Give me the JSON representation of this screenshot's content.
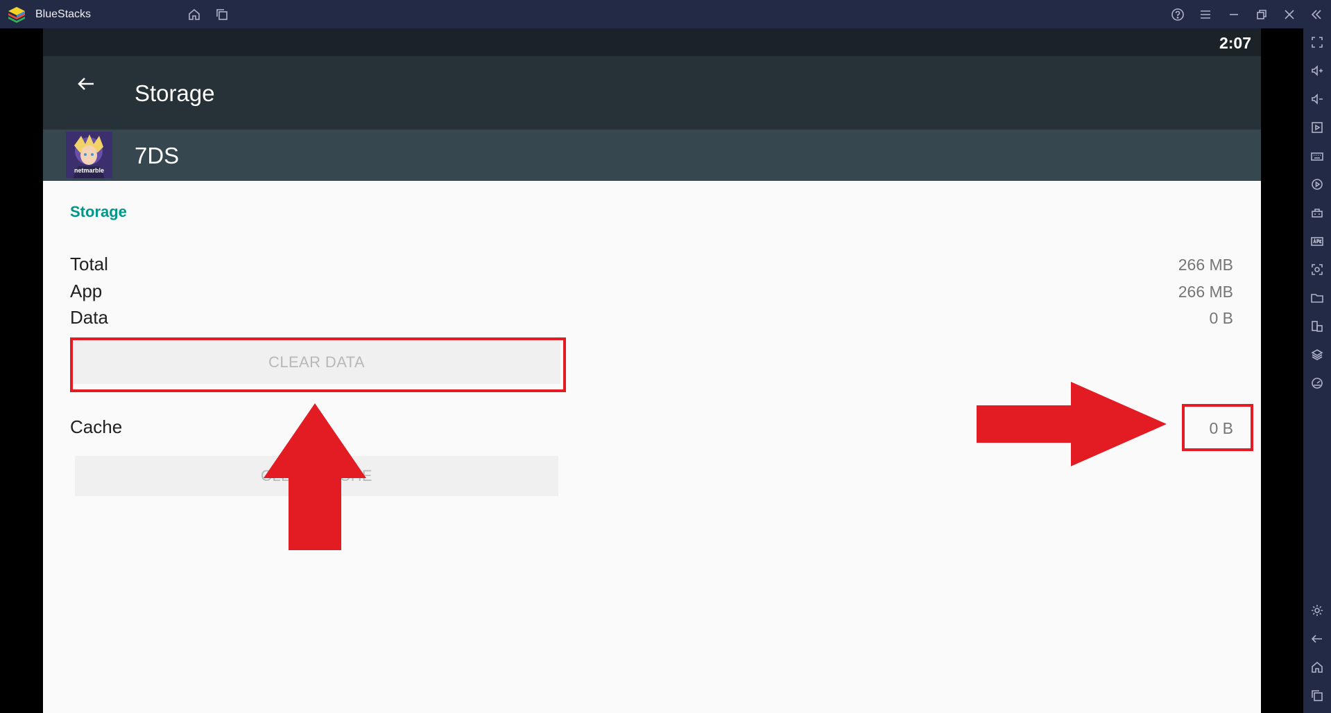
{
  "window": {
    "title": "BlueStacks",
    "titlebar_icons": [
      "home-icon",
      "multi-instance-icon",
      "help-icon",
      "menu-icon",
      "minimize-icon",
      "restore-icon",
      "close-icon",
      "collapse-sidebar-icon"
    ]
  },
  "sidebar": {
    "top_icons": [
      "fullscreen-icon",
      "volume-up-icon",
      "volume-down-icon",
      "media-icon",
      "keyboard-icon",
      "macro-icon",
      "gamepad-icon",
      "apk-icon",
      "screenshot-icon",
      "folder-icon",
      "multi-window-icon",
      "layers-icon",
      "eco-mode-icon"
    ],
    "bottom_icons": [
      "settings-icon",
      "back-icon",
      "home-icon",
      "recents-icon"
    ]
  },
  "android": {
    "status_time": "2:07",
    "page_title": "Storage",
    "app_name": "7DS",
    "app_icon_caption": "netmarble",
    "section_title": "Storage",
    "rows": [
      {
        "label": "Total",
        "value": "266 MB"
      },
      {
        "label": "App",
        "value": "266 MB"
      },
      {
        "label": "Data",
        "value": "0 B"
      }
    ],
    "clear_data_label": "CLEAR DATA",
    "cache_label": "Cache",
    "cache_value": "0 B",
    "clear_cache_label": "CLEAR CACHE"
  },
  "annotations": {
    "color": "#e31b23",
    "arrows": [
      "up-arrow",
      "right-arrow"
    ]
  },
  "colors": {
    "titlebar": "#232a45",
    "statusbar": "#1c2328",
    "actionbar": "#263238",
    "appheader": "#37474f",
    "accent": "#009688",
    "background": "#fafafa"
  }
}
